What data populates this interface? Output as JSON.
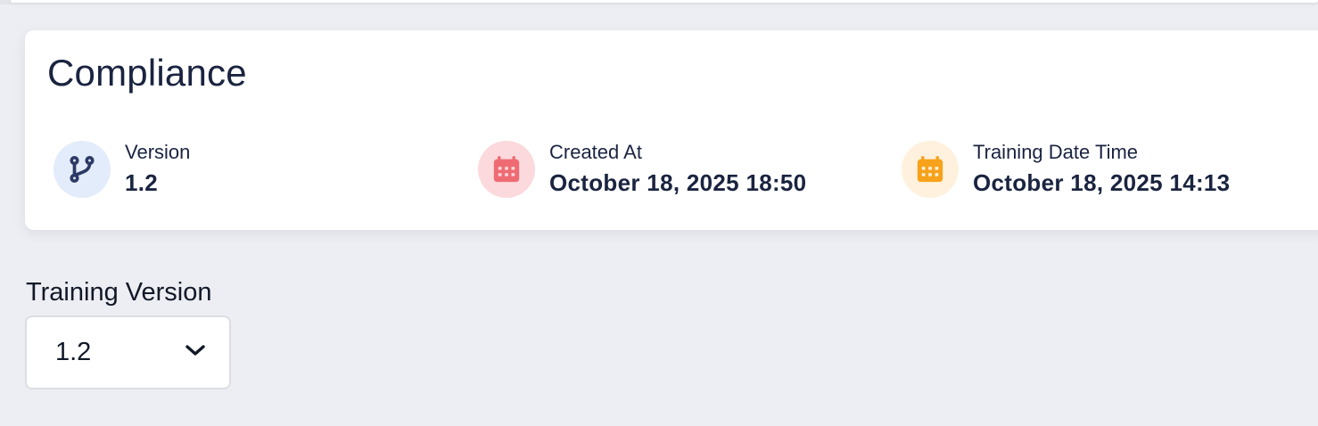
{
  "card": {
    "title": "Compliance",
    "meta": [
      {
        "icon": "git-branch-icon",
        "label": "Version",
        "value": "1.2",
        "color": "#2c3a66"
      },
      {
        "icon": "calendar-icon",
        "label": "Created At",
        "value": "October 18, 2025 18:50",
        "color": "#ef6b73"
      },
      {
        "icon": "calendar-icon",
        "label": "Training Date Time",
        "value": "October 18, 2025 14:13",
        "color": "#f7a21b"
      }
    ]
  },
  "training_version": {
    "label": "Training Version",
    "selected": "1.2"
  }
}
